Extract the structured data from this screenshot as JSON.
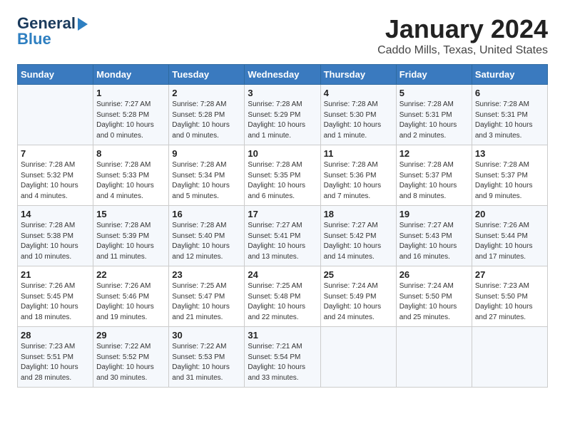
{
  "header": {
    "logo_line1": "General",
    "logo_line2": "Blue",
    "month": "January 2024",
    "location": "Caddo Mills, Texas, United States"
  },
  "weekdays": [
    "Sunday",
    "Monday",
    "Tuesday",
    "Wednesday",
    "Thursday",
    "Friday",
    "Saturday"
  ],
  "weeks": [
    [
      {
        "day": "",
        "info": ""
      },
      {
        "day": "1",
        "info": "Sunrise: 7:27 AM\nSunset: 5:28 PM\nDaylight: 10 hours\nand 0 minutes."
      },
      {
        "day": "2",
        "info": "Sunrise: 7:28 AM\nSunset: 5:28 PM\nDaylight: 10 hours\nand 0 minutes."
      },
      {
        "day": "3",
        "info": "Sunrise: 7:28 AM\nSunset: 5:29 PM\nDaylight: 10 hours\nand 1 minute."
      },
      {
        "day": "4",
        "info": "Sunrise: 7:28 AM\nSunset: 5:30 PM\nDaylight: 10 hours\nand 1 minute."
      },
      {
        "day": "5",
        "info": "Sunrise: 7:28 AM\nSunset: 5:31 PM\nDaylight: 10 hours\nand 2 minutes."
      },
      {
        "day": "6",
        "info": "Sunrise: 7:28 AM\nSunset: 5:31 PM\nDaylight: 10 hours\nand 3 minutes."
      }
    ],
    [
      {
        "day": "7",
        "info": "Sunrise: 7:28 AM\nSunset: 5:32 PM\nDaylight: 10 hours\nand 4 minutes."
      },
      {
        "day": "8",
        "info": "Sunrise: 7:28 AM\nSunset: 5:33 PM\nDaylight: 10 hours\nand 4 minutes."
      },
      {
        "day": "9",
        "info": "Sunrise: 7:28 AM\nSunset: 5:34 PM\nDaylight: 10 hours\nand 5 minutes."
      },
      {
        "day": "10",
        "info": "Sunrise: 7:28 AM\nSunset: 5:35 PM\nDaylight: 10 hours\nand 6 minutes."
      },
      {
        "day": "11",
        "info": "Sunrise: 7:28 AM\nSunset: 5:36 PM\nDaylight: 10 hours\nand 7 minutes."
      },
      {
        "day": "12",
        "info": "Sunrise: 7:28 AM\nSunset: 5:37 PM\nDaylight: 10 hours\nand 8 minutes."
      },
      {
        "day": "13",
        "info": "Sunrise: 7:28 AM\nSunset: 5:37 PM\nDaylight: 10 hours\nand 9 minutes."
      }
    ],
    [
      {
        "day": "14",
        "info": "Sunrise: 7:28 AM\nSunset: 5:38 PM\nDaylight: 10 hours\nand 10 minutes."
      },
      {
        "day": "15",
        "info": "Sunrise: 7:28 AM\nSunset: 5:39 PM\nDaylight: 10 hours\nand 11 minutes."
      },
      {
        "day": "16",
        "info": "Sunrise: 7:28 AM\nSunset: 5:40 PM\nDaylight: 10 hours\nand 12 minutes."
      },
      {
        "day": "17",
        "info": "Sunrise: 7:27 AM\nSunset: 5:41 PM\nDaylight: 10 hours\nand 13 minutes."
      },
      {
        "day": "18",
        "info": "Sunrise: 7:27 AM\nSunset: 5:42 PM\nDaylight: 10 hours\nand 14 minutes."
      },
      {
        "day": "19",
        "info": "Sunrise: 7:27 AM\nSunset: 5:43 PM\nDaylight: 10 hours\nand 16 minutes."
      },
      {
        "day": "20",
        "info": "Sunrise: 7:26 AM\nSunset: 5:44 PM\nDaylight: 10 hours\nand 17 minutes."
      }
    ],
    [
      {
        "day": "21",
        "info": "Sunrise: 7:26 AM\nSunset: 5:45 PM\nDaylight: 10 hours\nand 18 minutes."
      },
      {
        "day": "22",
        "info": "Sunrise: 7:26 AM\nSunset: 5:46 PM\nDaylight: 10 hours\nand 19 minutes."
      },
      {
        "day": "23",
        "info": "Sunrise: 7:25 AM\nSunset: 5:47 PM\nDaylight: 10 hours\nand 21 minutes."
      },
      {
        "day": "24",
        "info": "Sunrise: 7:25 AM\nSunset: 5:48 PM\nDaylight: 10 hours\nand 22 minutes."
      },
      {
        "day": "25",
        "info": "Sunrise: 7:24 AM\nSunset: 5:49 PM\nDaylight: 10 hours\nand 24 minutes."
      },
      {
        "day": "26",
        "info": "Sunrise: 7:24 AM\nSunset: 5:50 PM\nDaylight: 10 hours\nand 25 minutes."
      },
      {
        "day": "27",
        "info": "Sunrise: 7:23 AM\nSunset: 5:50 PM\nDaylight: 10 hours\nand 27 minutes."
      }
    ],
    [
      {
        "day": "28",
        "info": "Sunrise: 7:23 AM\nSunset: 5:51 PM\nDaylight: 10 hours\nand 28 minutes."
      },
      {
        "day": "29",
        "info": "Sunrise: 7:22 AM\nSunset: 5:52 PM\nDaylight: 10 hours\nand 30 minutes."
      },
      {
        "day": "30",
        "info": "Sunrise: 7:22 AM\nSunset: 5:53 PM\nDaylight: 10 hours\nand 31 minutes."
      },
      {
        "day": "31",
        "info": "Sunrise: 7:21 AM\nSunset: 5:54 PM\nDaylight: 10 hours\nand 33 minutes."
      },
      {
        "day": "",
        "info": ""
      },
      {
        "day": "",
        "info": ""
      },
      {
        "day": "",
        "info": ""
      }
    ]
  ]
}
